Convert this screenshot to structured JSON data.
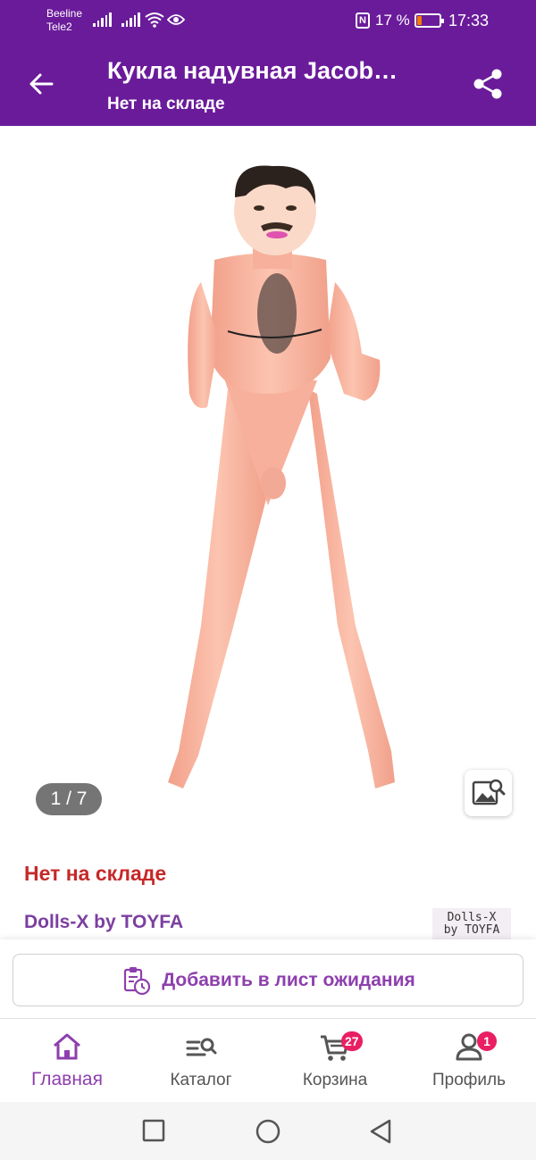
{
  "status_bar": {
    "carrier_1": "Beeline",
    "carrier_2": "Tele2",
    "battery_percent": "17 %",
    "time": "17:33",
    "nfc": "N"
  },
  "app_bar": {
    "title": "Кукла надувная Jacob…",
    "subtitle": "Нет на складе",
    "back_icon": "arrow-left-icon",
    "share_icon": "share-icon"
  },
  "gallery": {
    "counter": "1 / 7",
    "search_icon": "image-search-icon"
  },
  "product": {
    "stock_status": "Нет на складе",
    "brand": "Dolls-X by TOYFA",
    "brand_logo_line1": "Dolls-X",
    "brand_logo_line2": "by TOYFA"
  },
  "actions": {
    "waitlist_label": "Добавить в лист ожидания",
    "waitlist_icon": "clipboard-clock-icon"
  },
  "bottom_nav": {
    "items": [
      {
        "label": "Главная",
        "icon": "home-icon",
        "active": true
      },
      {
        "label": "Каталог",
        "icon": "catalog-search-icon"
      },
      {
        "label": "Корзина",
        "icon": "cart-icon",
        "badge": "27"
      },
      {
        "label": "Профиль",
        "icon": "profile-icon",
        "badge": "1"
      }
    ]
  },
  "colors": {
    "primary": "#6a1b9a",
    "accent": "#8e3fae",
    "out_of_stock": "#c62828",
    "badge": "#e91e63"
  }
}
